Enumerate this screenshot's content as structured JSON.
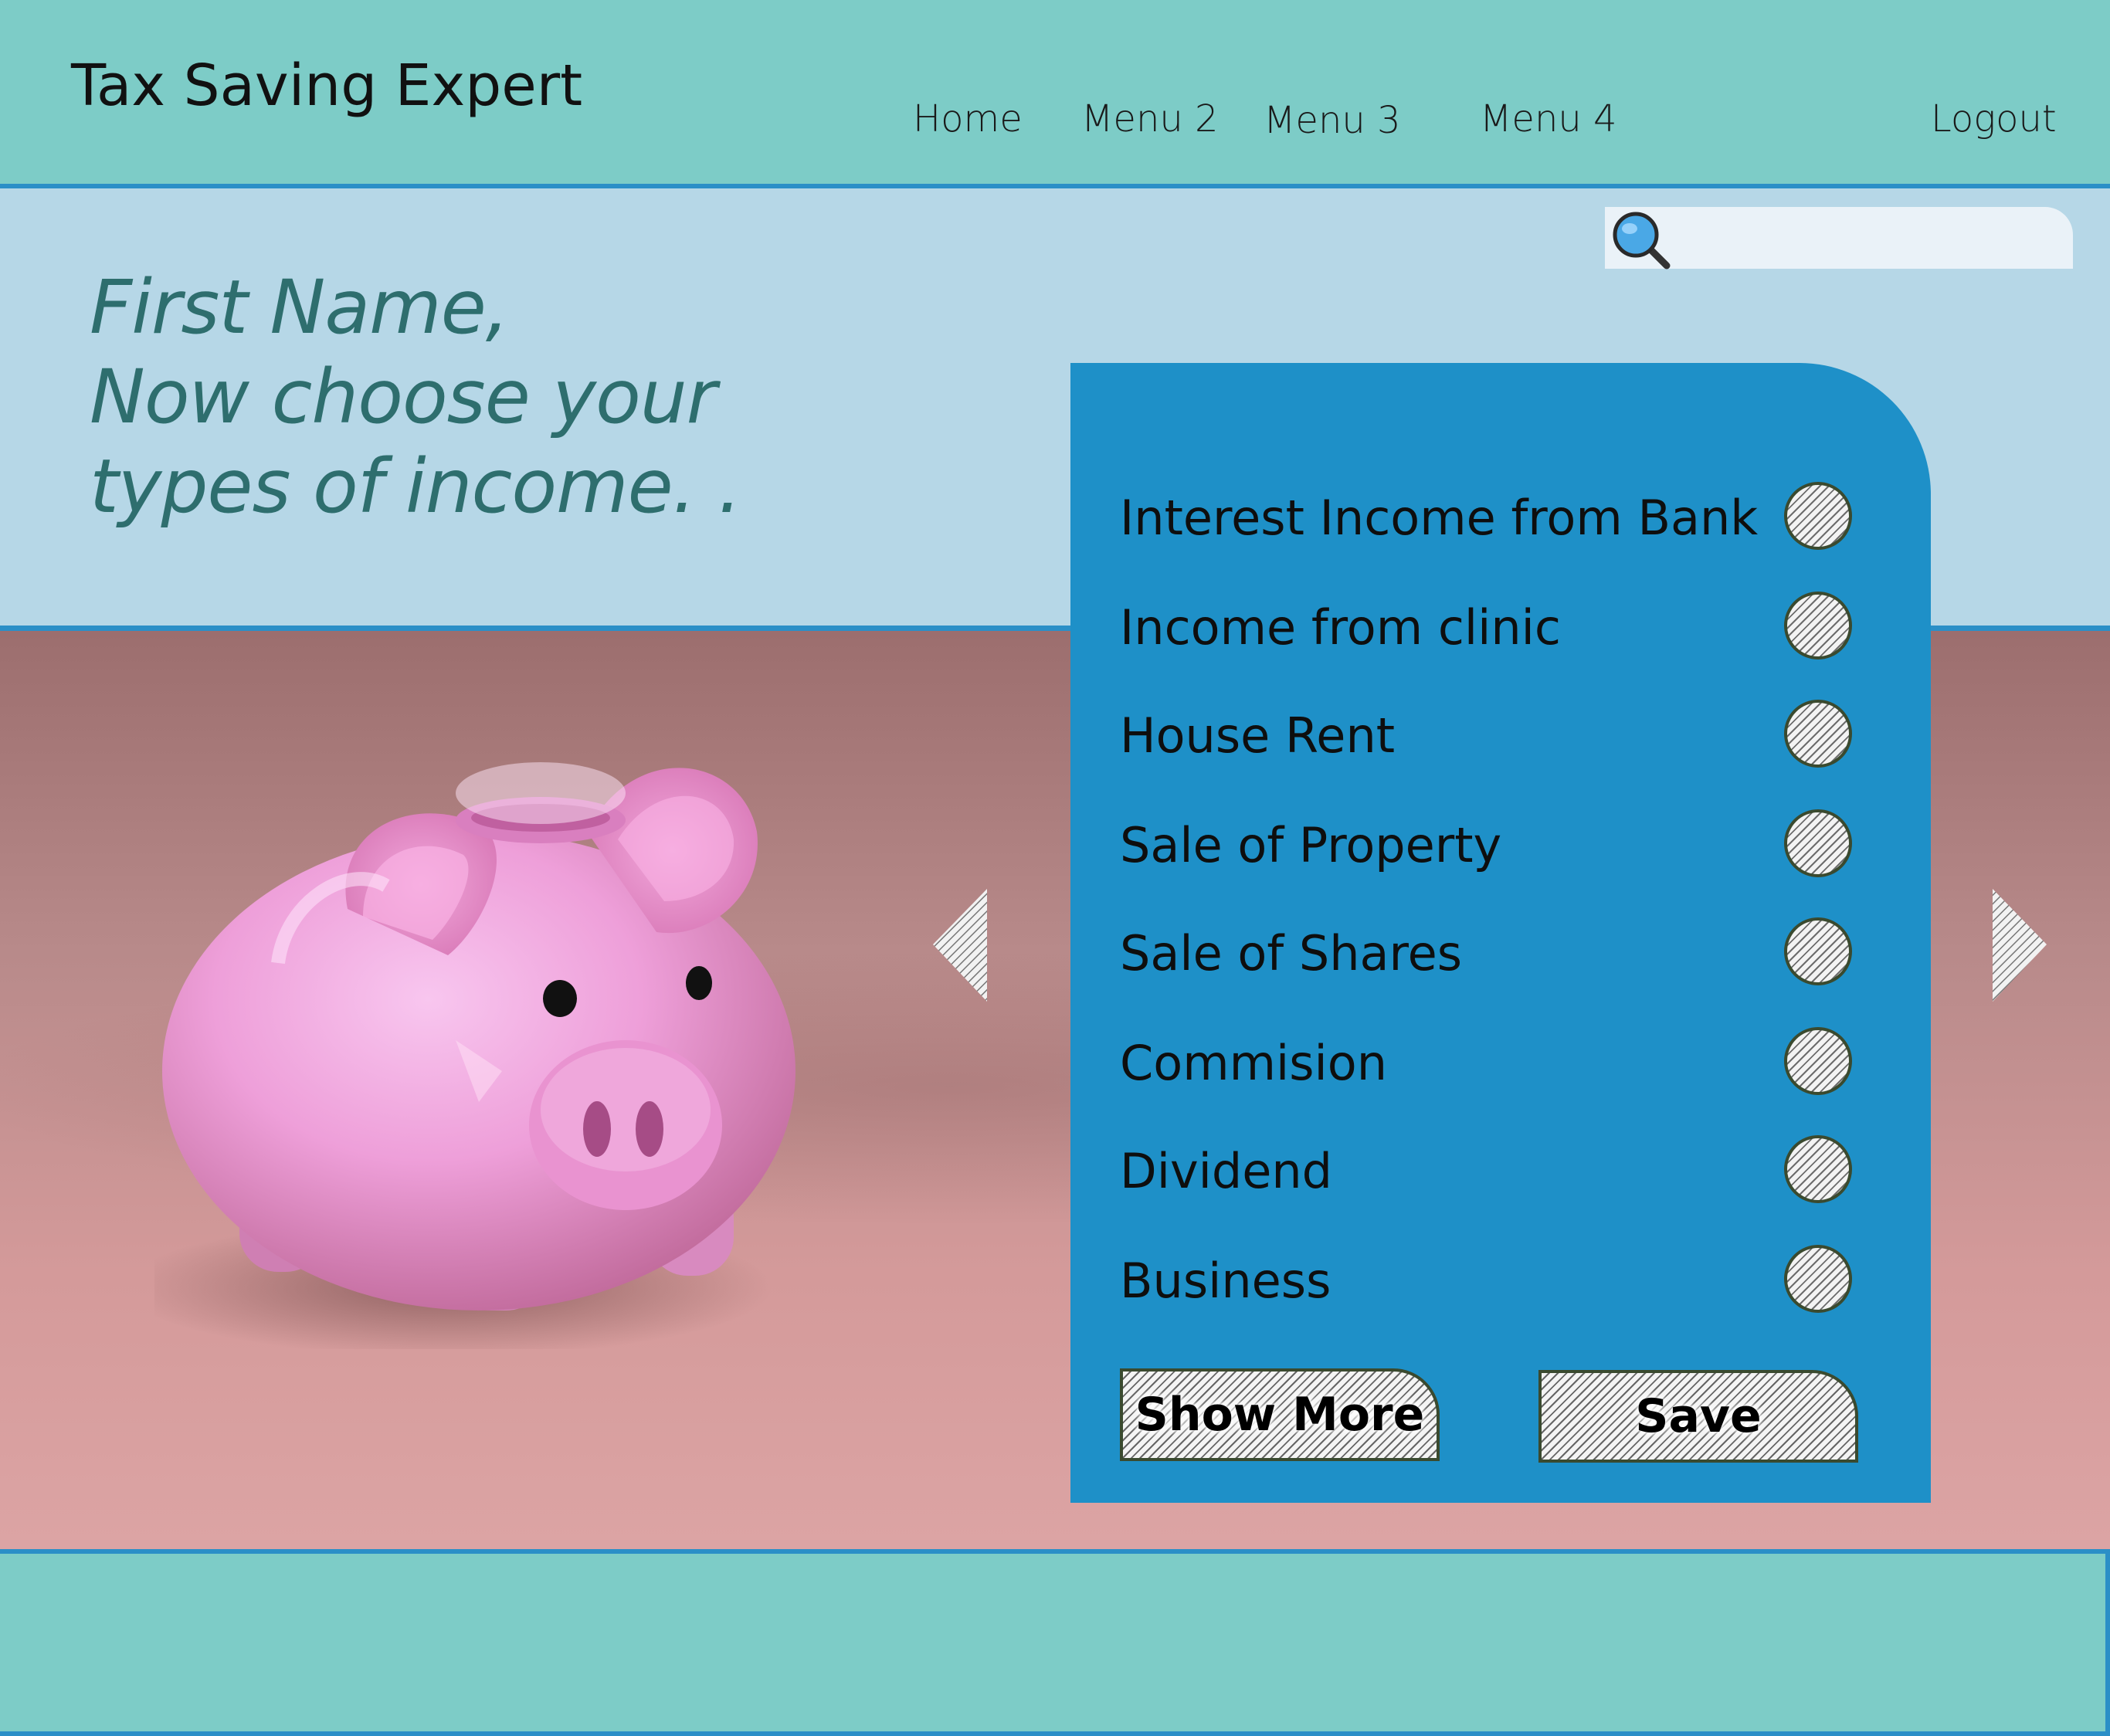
{
  "header": {
    "brand": "Tax Saving Expert",
    "nav": [
      "Home",
      "Menu 2",
      "Menu 3",
      "Menu 4"
    ],
    "logout": "Logout"
  },
  "search": {
    "placeholder": "",
    "value": ""
  },
  "greeting": {
    "line1": "First Name,",
    "line2": "Now choose your",
    "line3": "types of income. ."
  },
  "income_types": [
    "Interest Income from Bank",
    "Income from clinic",
    "House Rent",
    "Sale of Property",
    "Sale of Shares",
    "Commision",
    "Dividend",
    "Business"
  ],
  "buttons": {
    "show_more": "Show More",
    "save": "Save"
  },
  "colors": {
    "header_bg": "#7dccc7",
    "hero_bg": "#b6d7e7",
    "panel_bg": "#1e90c8",
    "accent_line": "#2b8fc7",
    "greeting_text": "#2e6e6e"
  },
  "icons": {
    "search": "search-icon",
    "carousel_prev": "triangle-left-icon",
    "carousel_next": "triangle-right-icon"
  }
}
